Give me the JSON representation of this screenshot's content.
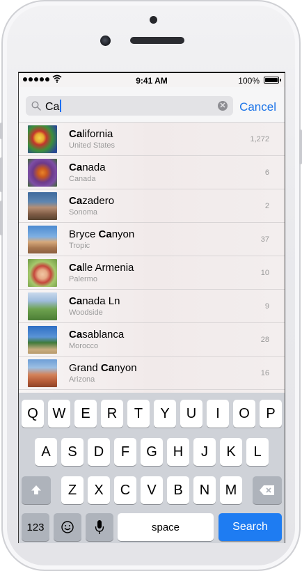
{
  "status": {
    "time": "9:41 AM",
    "battery": "100%"
  },
  "search": {
    "query": "Ca",
    "cancel_label": "Cancel"
  },
  "results": [
    {
      "prefix": "Ca",
      "rest": "lifornia",
      "pre": "",
      "subtitle": "United States",
      "count": "1,272"
    },
    {
      "prefix": "Ca",
      "rest": "nada",
      "pre": "",
      "subtitle": "Canada",
      "count": "6"
    },
    {
      "prefix": "Ca",
      "rest": "zadero",
      "pre": "",
      "subtitle": "Sonoma",
      "count": "2"
    },
    {
      "prefix": "Ca",
      "rest": "nyon",
      "pre": "Bryce ",
      "subtitle": "Tropic",
      "count": "37"
    },
    {
      "prefix": "Ca",
      "rest": "lle Armenia",
      "pre": "",
      "subtitle": "Palermo",
      "count": "10"
    },
    {
      "prefix": "Ca",
      "rest": "nada Ln",
      "pre": "",
      "subtitle": "Woodside",
      "count": "9"
    },
    {
      "prefix": "Ca",
      "rest": "sablanca",
      "pre": "",
      "subtitle": "Morocco",
      "count": "28"
    },
    {
      "prefix": "Ca",
      "rest": "nyon",
      "pre": "Grand ",
      "subtitle": "Arizona",
      "count": "16"
    }
  ],
  "keyboard": {
    "row1": [
      "Q",
      "W",
      "E",
      "R",
      "T",
      "Y",
      "U",
      "I",
      "O",
      "P"
    ],
    "row2": [
      "A",
      "S",
      "D",
      "F",
      "G",
      "H",
      "J",
      "K",
      "L"
    ],
    "row3": [
      "Z",
      "X",
      "C",
      "V",
      "B",
      "N",
      "M"
    ],
    "num_label": "123",
    "space_label": "space",
    "search_label": "Search"
  },
  "colors": {
    "accent": "#1a73e8",
    "search_key": "#1e7cf2"
  }
}
